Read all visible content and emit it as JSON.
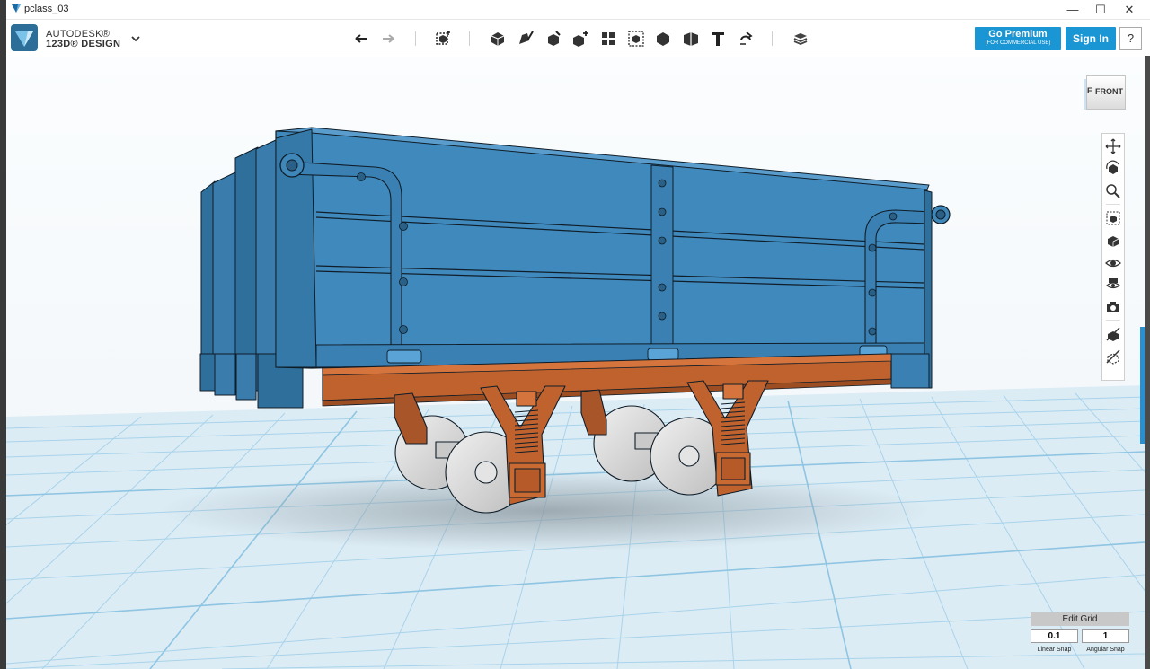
{
  "window": {
    "title": "pclass_03",
    "minimize": "—",
    "maximize": "☐",
    "close": "✕"
  },
  "brand": {
    "line1": "AUTODESK®",
    "line2": "123D® DESIGN"
  },
  "toolbar": {
    "tools": [
      {
        "name": "undo-icon",
        "interactable": true
      },
      {
        "name": "redo-icon",
        "interactable": true
      },
      {
        "name": "transform-icon",
        "interactable": true
      },
      {
        "name": "primitives-icon",
        "interactable": true
      },
      {
        "name": "sketch-icon",
        "interactable": true
      },
      {
        "name": "construct-icon",
        "interactable": true
      },
      {
        "name": "modify-icon",
        "interactable": true
      },
      {
        "name": "pattern-icon",
        "interactable": true
      },
      {
        "name": "group-icon",
        "interactable": true
      },
      {
        "name": "combine-icon",
        "interactable": true
      },
      {
        "name": "measure-icon",
        "interactable": true
      },
      {
        "name": "text-icon",
        "interactable": true
      },
      {
        "name": "snap-icon",
        "interactable": true
      },
      {
        "name": "material-icon",
        "interactable": true
      }
    ]
  },
  "header_buttons": {
    "premium_label": "Go Premium",
    "premium_sub": "(FOR COMMERCIAL USE)",
    "signin_label": "Sign In",
    "help_label": "?"
  },
  "viewcube": {
    "face_label": "FRONT",
    "side_label": "F"
  },
  "nav_tools": [
    "pan-icon",
    "orbit-icon",
    "zoom-icon",
    "fit-icon",
    "views-icon",
    "visibility-icon",
    "material-display-icon",
    "screenshot-icon",
    "show-hide-icon",
    "hide-icon"
  ],
  "grid": {
    "edit_label": "Edit Grid",
    "linear_value": "0.1",
    "angular_value": "1",
    "linear_label": "Linear Snap",
    "angular_label": "Angular Snap"
  },
  "colors": {
    "accent": "#1a96d4",
    "wagon_body": "#3d86b8",
    "chassis": "#c0622e",
    "wheel": "#dadada",
    "grid_bg": "#dcecf5",
    "grid_line": "#a9d3ea"
  }
}
